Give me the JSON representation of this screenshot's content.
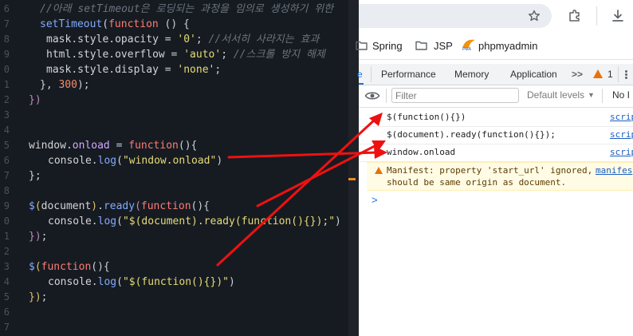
{
  "editor": {
    "gutter": [
      "6",
      "7",
      "8",
      "9",
      "0",
      "1",
      "2",
      "3",
      "4",
      "5",
      "6",
      "7",
      "8",
      "9",
      "0",
      "1",
      "2",
      "3",
      "4",
      "5",
      "6",
      "7"
    ],
    "comment": "//아래 setTimeout은 로딩되는 과정을 임의로 생성하기 위한",
    "code": {
      "setTimeout": "setTimeout",
      "function": "function",
      "mask": "mask",
      "style": "style",
      "opacity": "opacity",
      "val_zero": "'0'",
      "comment_fade": "//서서히 사라지는 효과",
      "html": "html",
      "overflow": "overflow",
      "val_auto": "'auto'",
      "comment_scroll": "//스크롤 방지 해제",
      "display": "display",
      "val_none": "'none'",
      "num_300": "300",
      "window": "window",
      "onload": "onload",
      "console": "console",
      "log": "log",
      "str_window_onload": "\"window.onload\"",
      "dollar": "$",
      "document": "document",
      "ready": "ready",
      "str_doc_ready": "\"$(document).ready(function(){});\"",
      "str_dollar_fn": "\"$(function(){})\""
    }
  },
  "browser": {
    "bookmarks": [
      "Spring",
      "JSP",
      "phpmyadmin"
    ],
    "pma_logo_text": "PMA",
    "devtools": {
      "tab_partial": "e",
      "tabs": [
        "Performance",
        "Memory",
        "Application"
      ],
      "more": ">>",
      "warn_count": "1",
      "filter_placeholder": "Filter",
      "levels": "Default levels",
      "no_issues": "No I",
      "logs": [
        {
          "message": "$(function(){})",
          "source": "scrip"
        },
        {
          "message": "$(document).ready(function(){});",
          "source": "scrip"
        },
        {
          "message": "window.onload",
          "source": "scrip"
        }
      ],
      "warning": {
        "line1": "Manifest: property 'start_url' ignored,",
        "line2": "should be same origin as document.",
        "source": "manifes"
      },
      "prompt": ">"
    }
  },
  "colors": {
    "editor_bg": "#161b22",
    "arrow": "#ee1111",
    "link": "#1a5fbf",
    "warning_bg": "#fffbe5",
    "accent": "#1a73e8"
  }
}
